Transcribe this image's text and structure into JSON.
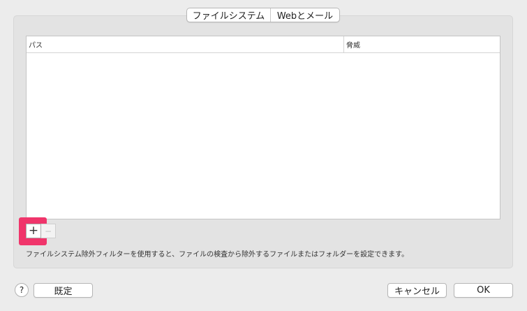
{
  "tabs": [
    {
      "label": "ファイルシステム"
    },
    {
      "label": "Webとメール"
    }
  ],
  "table": {
    "columns": [
      {
        "label": "パス"
      },
      {
        "label": "脅威"
      }
    ],
    "rows": []
  },
  "list_controls": {
    "add_label": "+",
    "remove_label": "−"
  },
  "description": "ファイルシステム除外フィルターを使用すると、ファイルの検査から除外するファイルまたはフォルダーを設定できます。",
  "footer": {
    "help_label": "?",
    "default_label": "既定",
    "cancel_label": "キャンセル",
    "ok_label": "OK"
  },
  "colors": {
    "highlight": "#f0356b"
  }
}
